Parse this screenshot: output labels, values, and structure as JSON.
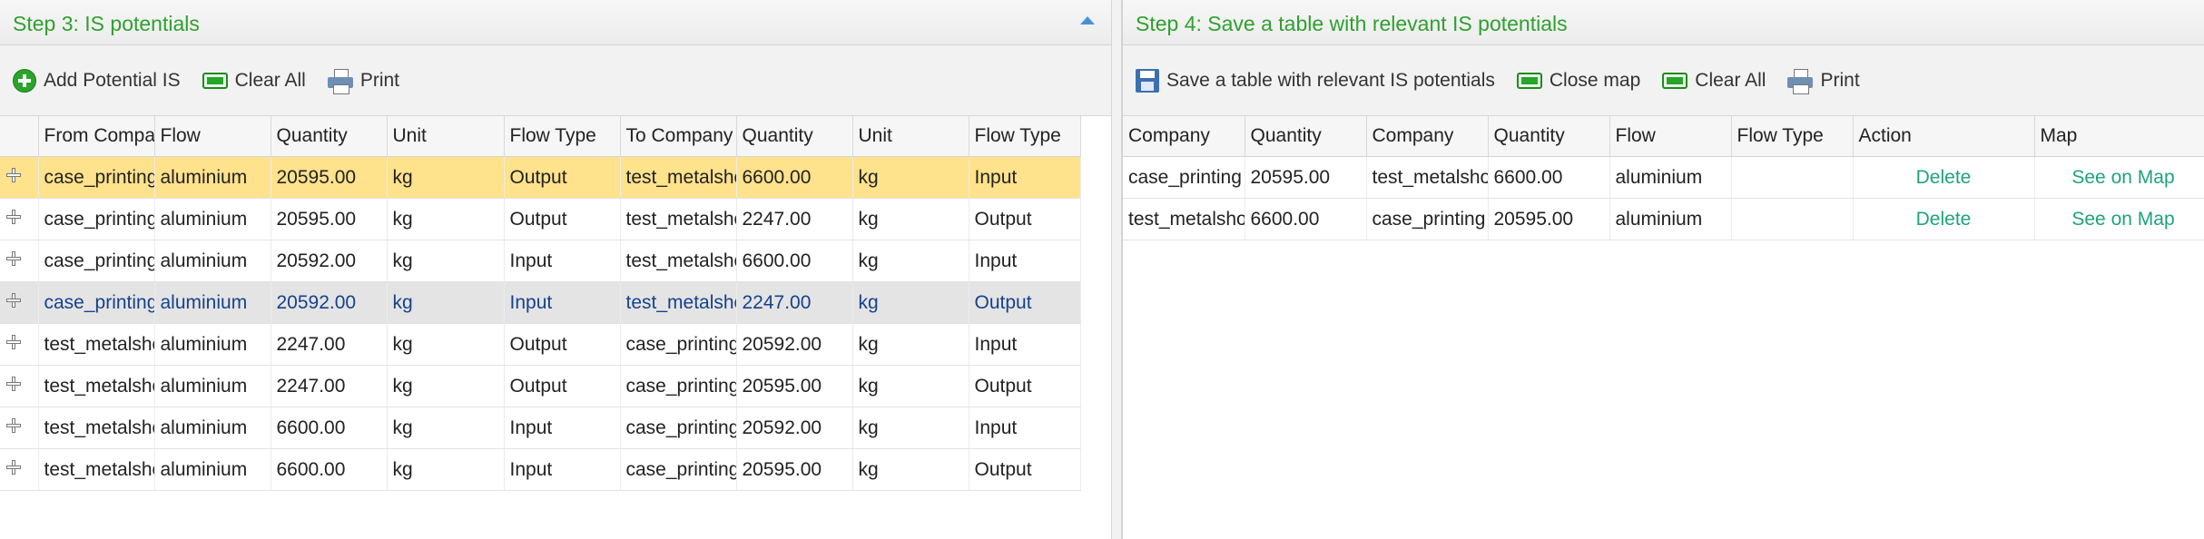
{
  "left": {
    "title": "Step 3: IS potentials",
    "toolbar": {
      "add": "Add Potential IS",
      "clear": "Clear All",
      "print": "Print"
    },
    "columns": [
      "From Company",
      "Flow",
      "Quantity",
      "Unit",
      "Flow Type",
      "To Company",
      "Quantity",
      "Unit",
      "Flow Type"
    ],
    "rows": [
      [
        "case_printing",
        "aluminium",
        "20595.00",
        "kg",
        "Output",
        "test_metalshop",
        "6600.00",
        "kg",
        "Input"
      ],
      [
        "case_printing",
        "aluminium",
        "20595.00",
        "kg",
        "Output",
        "test_metalshop",
        "2247.00",
        "kg",
        "Output"
      ],
      [
        "case_printing",
        "aluminium",
        "20592.00",
        "kg",
        "Input",
        "test_metalshop",
        "6600.00",
        "kg",
        "Input"
      ],
      [
        "case_printing",
        "aluminium",
        "20592.00",
        "kg",
        "Input",
        "test_metalshop",
        "2247.00",
        "kg",
        "Output"
      ],
      [
        "test_metalshop",
        "aluminium",
        "2247.00",
        "kg",
        "Output",
        "case_printing",
        "20592.00",
        "kg",
        "Input"
      ],
      [
        "test_metalshop",
        "aluminium",
        "2247.00",
        "kg",
        "Output",
        "case_printing",
        "20595.00",
        "kg",
        "Output"
      ],
      [
        "test_metalshop",
        "aluminium",
        "6600.00",
        "kg",
        "Input",
        "case_printing",
        "20592.00",
        "kg",
        "Input"
      ],
      [
        "test_metalshop",
        "aluminium",
        "6600.00",
        "kg",
        "Input",
        "case_printing",
        "20595.00",
        "kg",
        "Output"
      ]
    ]
  },
  "right": {
    "title": "Step 4: Save a table with relevant IS potentials",
    "toolbar": {
      "save": "Save a table with relevant IS potentials",
      "close_map": "Close map",
      "clear": "Clear All",
      "print": "Print"
    },
    "columns": [
      "Company",
      "Quantity",
      "Company",
      "Quantity",
      "Flow",
      "Flow Type",
      "Action",
      "Map"
    ],
    "rows": [
      [
        "case_printing",
        "20595.00",
        "test_metalshop",
        "6600.00",
        "aluminium",
        "",
        "Delete",
        "See on Map"
      ],
      [
        "test_metalshop",
        "6600.00",
        "case_printing",
        "20595.00",
        "aluminium",
        "",
        "Delete",
        "See on Map"
      ]
    ]
  }
}
